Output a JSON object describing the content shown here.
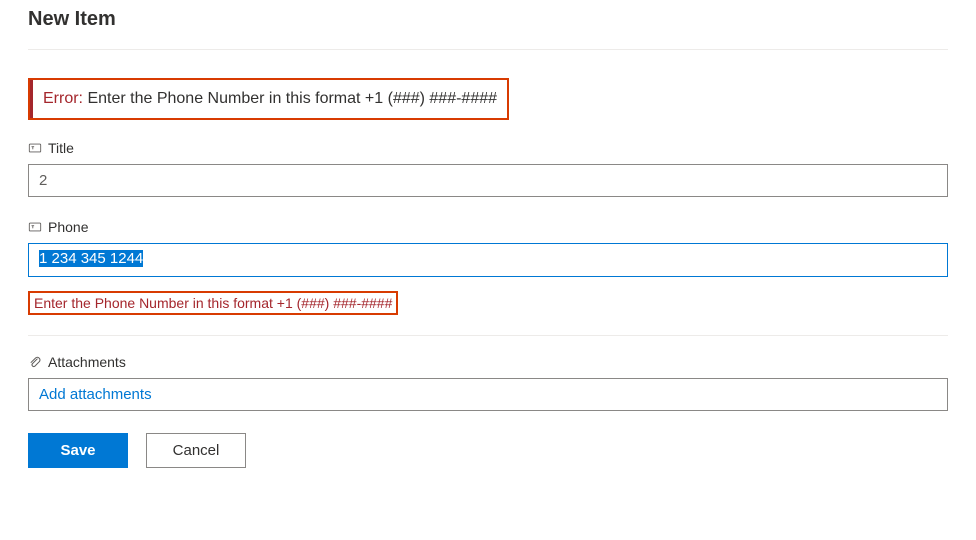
{
  "header": {
    "title": "New Item"
  },
  "error_banner": {
    "label": "Error:",
    "message": "Enter the Phone Number in this format +1 (###) ###-####"
  },
  "fields": {
    "title": {
      "label": "Title",
      "value": "2"
    },
    "phone": {
      "label": "Phone",
      "value": "1 234 345 1244",
      "inline_error": "Enter the Phone Number in this format +1 (###) ###-####"
    },
    "attachments": {
      "label": "Attachments",
      "link_text": "Add attachments"
    }
  },
  "buttons": {
    "save": "Save",
    "cancel": "Cancel"
  }
}
